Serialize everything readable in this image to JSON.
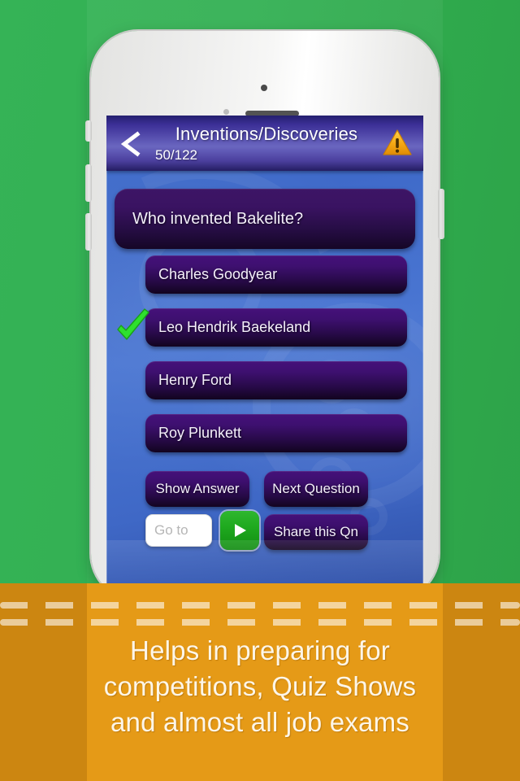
{
  "app": {
    "header": {
      "back_icon": "back-chevron-icon",
      "title": "Inventions/Discoveries",
      "counter": "50/122",
      "warning_icon": "warning-triangle-icon"
    },
    "question": {
      "text": "Who invented Bakelite?"
    },
    "answers": [
      {
        "label": "Charles Goodyear",
        "correct": false
      },
      {
        "label": "Leo Hendrik Baekeland",
        "correct": true
      },
      {
        "label": "Henry Ford",
        "correct": false
      },
      {
        "label": "Roy Plunkett",
        "correct": false
      }
    ],
    "correct_marker_icon": "green-checkmark-icon",
    "actions": {
      "show_answer": "Show Answer",
      "next_question": "Next Question",
      "share": "Share this Qn",
      "goto_placeholder": "Go to",
      "goto_value": "",
      "go_icon": "play-triangle-icon"
    }
  },
  "promo": {
    "caption_line1": "Helps in preparing for",
    "caption_line2": "competitions, Quiz Shows",
    "caption_line3": "and  almost all job exams"
  },
  "device": {
    "camera_icon": "front-camera-icon",
    "sensor_icon": "proximity-sensor-icon",
    "speaker_icon": "earpiece-speaker-icon",
    "silent_switch_icon": "silent-switch-icon",
    "volume_up_icon": "volume-up-button-icon",
    "volume_down_icon": "volume-down-button-icon",
    "power_icon": "power-button-icon"
  },
  "colors": {
    "background_green": "#33b053",
    "footer_orange": "#e59a17",
    "footer_orange_dark": "#cc8611",
    "screen_blue": "#4a76d2",
    "card_purple": "#3d1566",
    "accent_green": "#1faa1f",
    "warning_yellow": "#f5a814"
  }
}
